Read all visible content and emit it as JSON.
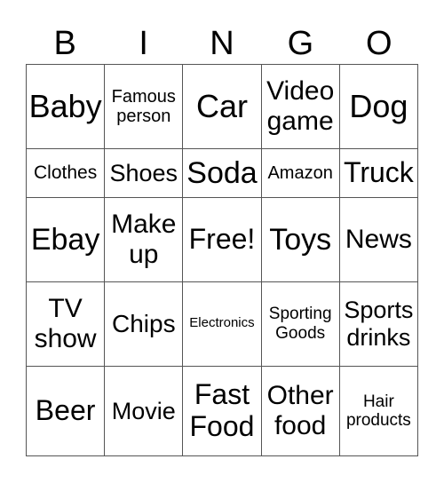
{
  "header": [
    "B",
    "I",
    "N",
    "G",
    "O"
  ],
  "cells": [
    [
      {
        "text": "Baby",
        "size": 36
      },
      {
        "text": "Famous person",
        "size": 20
      },
      {
        "text": "Car",
        "size": 36
      },
      {
        "text": "Video game",
        "size": 30
      },
      {
        "text": "Dog",
        "size": 36
      }
    ],
    [
      {
        "text": "Clothes",
        "size": 21
      },
      {
        "text": "Shoes",
        "size": 27
      },
      {
        "text": "Soda",
        "size": 34
      },
      {
        "text": "Amazon",
        "size": 20
      },
      {
        "text": "Truck",
        "size": 32
      }
    ],
    [
      {
        "text": "Ebay",
        "size": 34
      },
      {
        "text": "Make up",
        "size": 30
      },
      {
        "text": "Free!",
        "size": 32
      },
      {
        "text": "Toys",
        "size": 34
      },
      {
        "text": "News",
        "size": 30
      }
    ],
    [
      {
        "text": "TV show",
        "size": 30
      },
      {
        "text": "Chips",
        "size": 28
      },
      {
        "text": "Electronics",
        "size": 15
      },
      {
        "text": "Sporting Goods",
        "size": 19
      },
      {
        "text": "Sports drinks",
        "size": 27
      }
    ],
    [
      {
        "text": "Beer",
        "size": 32
      },
      {
        "text": "Movie",
        "size": 27
      },
      {
        "text": "Fast Food",
        "size": 32
      },
      {
        "text": "Other food",
        "size": 30
      },
      {
        "text": "Hair products",
        "size": 19
      }
    ]
  ]
}
